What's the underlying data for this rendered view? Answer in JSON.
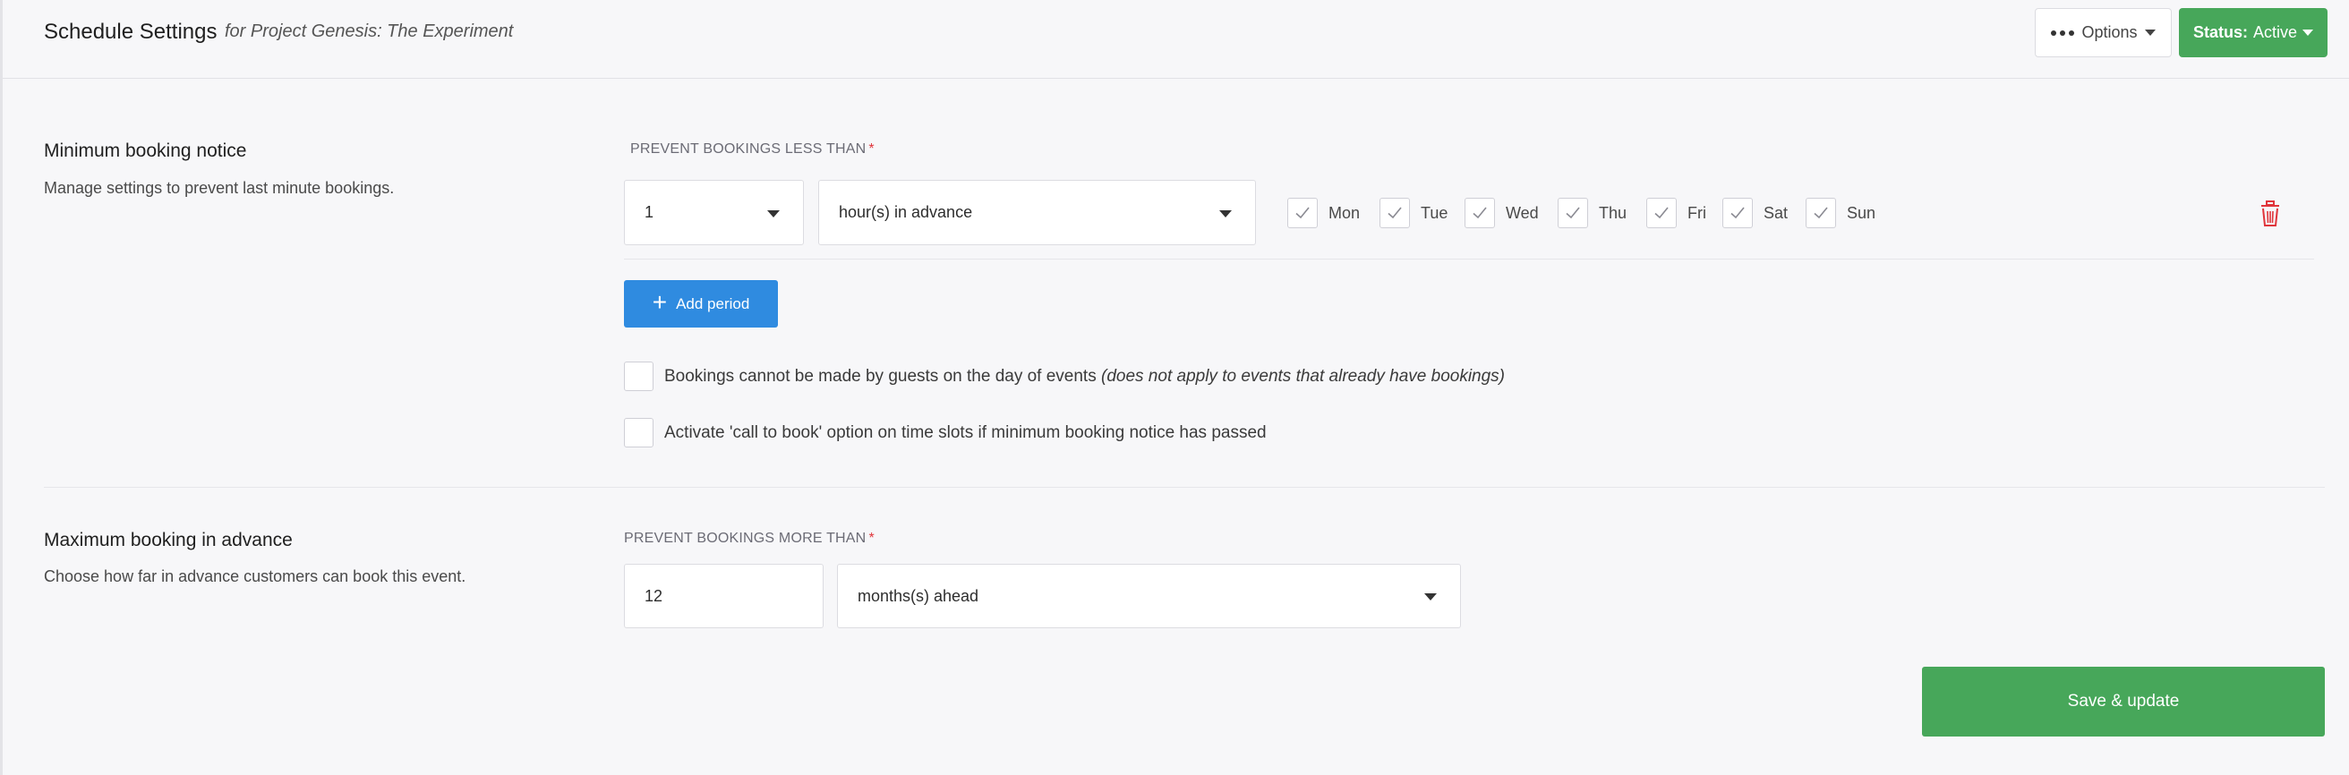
{
  "header": {
    "title": "Schedule Settings",
    "subtitle": "for Project Genesis: The Experiment",
    "options_label": "Options",
    "status_prefix": "Status:",
    "status_value": "Active"
  },
  "minimum": {
    "title": "Minimum booking notice",
    "description": "Manage settings to prevent last minute bookings.",
    "field_label": "PREVENT BOOKINGS LESS THAN",
    "amount": "1",
    "unit": "hour(s) in advance",
    "days": [
      {
        "label": "Mon",
        "checked": true
      },
      {
        "label": "Tue",
        "checked": true
      },
      {
        "label": "Wed",
        "checked": true
      },
      {
        "label": "Thu",
        "checked": true
      },
      {
        "label": "Fri",
        "checked": true
      },
      {
        "label": "Sat",
        "checked": true
      },
      {
        "label": "Sun",
        "checked": true
      }
    ],
    "add_period_label": "Add period",
    "option_same_day": "Bookings cannot be made by guests on the day of events",
    "option_same_day_note": "(does not apply to events that already have bookings)",
    "option_call_to_book": "Activate 'call to book' option on time slots if minimum booking notice has passed"
  },
  "maximum": {
    "title": "Maximum booking in advance",
    "description": "Choose how far in advance customers can book this event.",
    "field_label": "PREVENT BOOKINGS MORE THAN",
    "amount": "12",
    "unit": "months(s) ahead"
  },
  "footer": {
    "save_label": "Save & update"
  },
  "colors": {
    "primary_green": "#47a75a",
    "primary_blue": "#2f8be0",
    "danger_red": "#e0353b"
  }
}
